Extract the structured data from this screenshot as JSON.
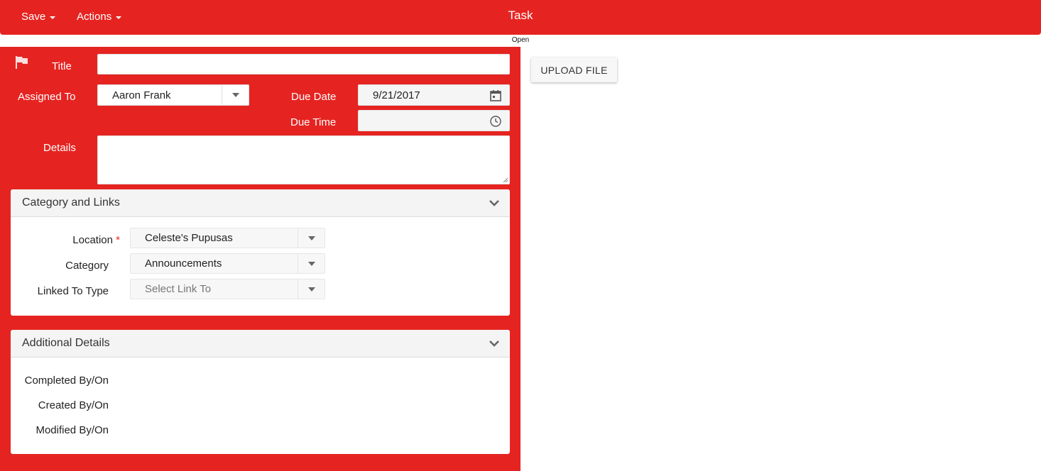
{
  "toolbar": {
    "save_label": "Save",
    "actions_label": "Actions"
  },
  "header": {
    "title": "Task",
    "status": "Open"
  },
  "form": {
    "title_label": "Title",
    "title_value": "",
    "assigned_label": "Assigned To",
    "assigned_value": "Aaron Frank",
    "due_date_label": "Due Date",
    "due_date_value": "9/21/2017",
    "due_time_label": "Due Time",
    "due_time_value": "",
    "details_label": "Details"
  },
  "category_card": {
    "title": "Category and Links",
    "location_label": "Location",
    "location_required": "*",
    "location_value": "Celeste's Pupusas",
    "category_label": "Category",
    "category_value": "Announcements",
    "linked_label": "Linked To Type",
    "linked_placeholder": "Select Link To"
  },
  "additional_card": {
    "title": "Additional Details",
    "completed_label": "Completed By/On",
    "created_label": "Created By/On",
    "modified_label": "Modified By/On"
  },
  "upload": {
    "label": "UPLOAD FILE"
  },
  "icons": {
    "flag": "flag-icon",
    "calendar": "calendar-icon",
    "clock": "clock-icon",
    "chevron": "chevron-down-icon",
    "dropdown": "caret-down-icon"
  },
  "colors": {
    "accent": "#e52421",
    "card_header": "#f4f4f4"
  }
}
